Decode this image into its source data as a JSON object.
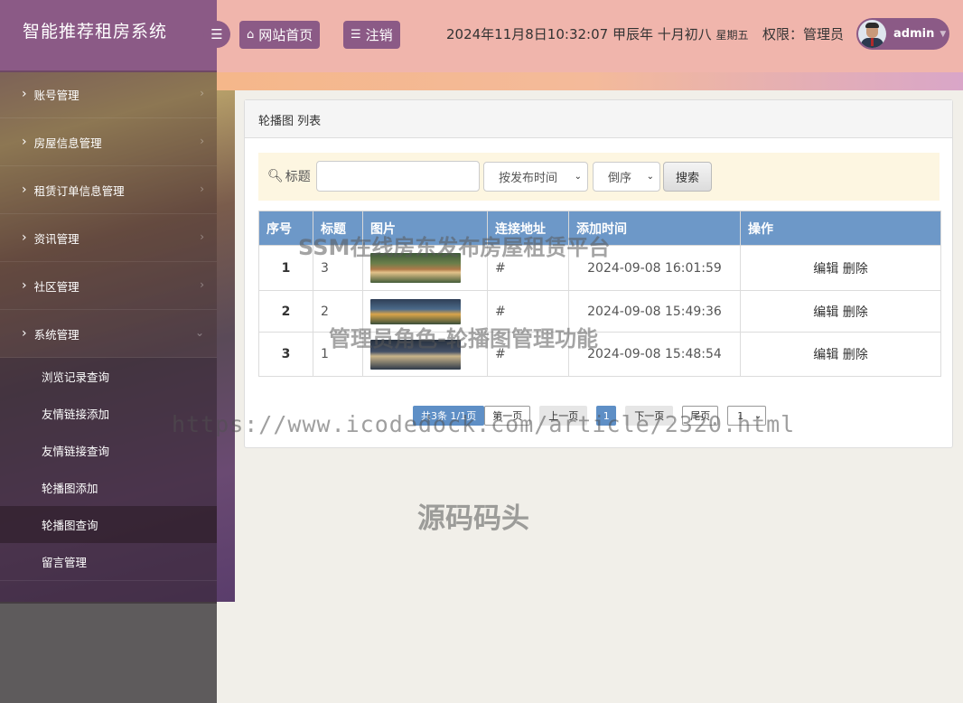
{
  "brand": {
    "title": "智能推荐租房系统"
  },
  "sidebar": {
    "items": [
      {
        "label": "账号管理"
      },
      {
        "label": "房屋信息管理"
      },
      {
        "label": "租赁订单信息管理"
      },
      {
        "label": "资讯管理"
      },
      {
        "label": "社区管理"
      },
      {
        "label": "系统管理"
      }
    ],
    "submenu": [
      {
        "label": "浏览记录查询"
      },
      {
        "label": "友情链接添加"
      },
      {
        "label": "友情链接查询"
      },
      {
        "label": "轮播图添加"
      },
      {
        "label": "轮播图查询"
      },
      {
        "label": "留言管理"
      }
    ]
  },
  "header": {
    "home_label": "网站首页",
    "logout_label": "注销",
    "datetime": "2024年11月8日10:32:07 甲辰年 十月初八",
    "weekday": "星期五",
    "permission": "权限：管理员",
    "username": "admin"
  },
  "panel": {
    "title": "轮播图 列表"
  },
  "search": {
    "label": "标题",
    "input_value": "",
    "sort_field": "按发布时间",
    "sort_order": "倒序",
    "button_label": "搜索"
  },
  "table": {
    "headers": [
      "序号",
      "标题",
      "图片",
      "连接地址",
      "添加时间",
      "操作"
    ],
    "rows": [
      {
        "seq": "1",
        "title": "3",
        "link": "#",
        "time": "2024-09-08 16:01:59",
        "edit": "编辑",
        "delete": "删除"
      },
      {
        "seq": "2",
        "title": "2",
        "link": "#",
        "time": "2024-09-08 15:49:36",
        "edit": "编辑",
        "delete": "删除"
      },
      {
        "seq": "3",
        "title": "1",
        "link": "#",
        "time": "2024-09-08 15:48:54",
        "edit": "编辑",
        "delete": "删除"
      }
    ]
  },
  "pager": {
    "info": "共3条   1/1页",
    "first": "第一页",
    "prev": "上一页",
    "current": "1",
    "next": "下一页",
    "last": "尾页",
    "select_value": "1"
  },
  "watermarks": {
    "line1": "SSM在线房东发布房屋租赁平台",
    "line2": "管理员角色-轮播图管理功能",
    "line3": "https://www.icodedock.com/article/2320.html",
    "line4": "源码码头"
  },
  "colors": {
    "brand": "#8b5a86",
    "header_bg": "#f0b5ac",
    "table_header": "#6d98c8",
    "search_bar": "#fdf6e1"
  },
  "icons": {
    "menu_toggle": "bars-icon",
    "home": "home-icon",
    "logout": "bars-icon",
    "search": "search-icon"
  }
}
